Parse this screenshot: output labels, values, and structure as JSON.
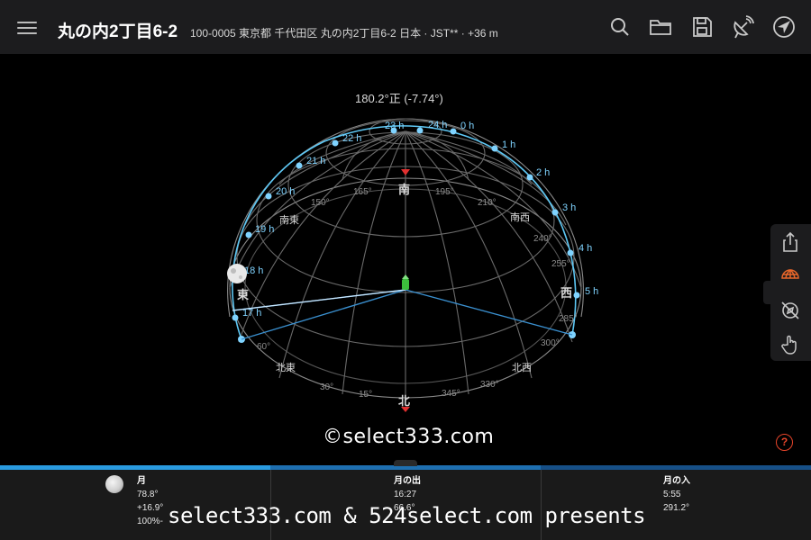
{
  "header": {
    "title": "丸の内2丁目6-2",
    "address": "100-0005 東京都 千代田区 丸の内2丁目6-2 日本 · JST** · +36 m"
  },
  "toolbar": {
    "icons": [
      "search-icon",
      "folder-icon",
      "save-icon",
      "satellite-dish-icon",
      "navigate-arrow-icon"
    ]
  },
  "sky": {
    "azimuth_readout": "180.2°正 (-7.74°)",
    "hour_labels": [
      "23 h",
      "24 h",
      "0 h",
      "22 h",
      "1 h",
      "21 h",
      "2 h",
      "20 h",
      "3 h",
      "19 h",
      "4 h",
      "18 h",
      "5 h",
      "17 h"
    ],
    "directions": {
      "south": "南",
      "north": "北",
      "east": "東",
      "west": "西",
      "southeast": "南東",
      "southwest": "南西",
      "northeast": "北東",
      "northwest": "北西"
    },
    "degree_labels": [
      "165°",
      "195°",
      "150°",
      "210°",
      "240°",
      "255°",
      "285°",
      "300°",
      "330°",
      "345°",
      "15°",
      "30°",
      "60°"
    ]
  },
  "side_panel": {
    "icons": [
      "share-icon",
      "globe-grid-icon",
      "compass-off-icon",
      "hand-pointer-icon"
    ]
  },
  "help": "?",
  "watermarks": {
    "center": "©select333.com",
    "bottom": "select333.com & 524select.com presents"
  },
  "info": {
    "moon": {
      "label": "月",
      "azimuth": "78.8°",
      "altitude": "+16.9°",
      "illumination": "100%-"
    },
    "moonrise": {
      "label": "月の出",
      "time": "16:27",
      "azimuth": "66.6°"
    },
    "moonset": {
      "label": "月の入",
      "time": "5:55",
      "azimuth": "291.2°"
    }
  },
  "colors": {
    "accent": "#5ec8f5",
    "bar_light": "#2a9be0",
    "bar_mid": "#1e6fb0",
    "bar_dark": "#164f86",
    "help": "#e8452a"
  }
}
